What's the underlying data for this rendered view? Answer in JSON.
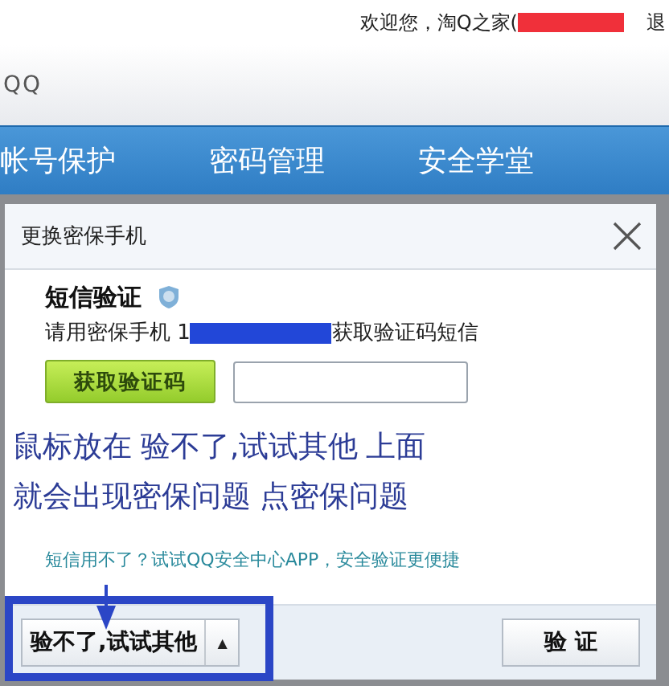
{
  "top_bar": {
    "welcome": "欢迎您，淘Q之家(",
    "logout": "退"
  },
  "header": {
    "logo_text": "QQ"
  },
  "nav": {
    "tabs": [
      {
        "label": "帐号保护",
        "selected": false
      },
      {
        "label": "密码管理",
        "selected": false
      },
      {
        "label": "安全学堂",
        "selected": false
      }
    ]
  },
  "dialog": {
    "title": "更换密保手机",
    "section_title": "短信验证",
    "instruction_prefix": "请用密保手机 1",
    "instruction_suffix": "获取验证码短信",
    "get_code_button": "获取验证码",
    "annotation": [
      "鼠标放在 验不了,试试其他 上面",
      "就会出现密保问题 点密保问题"
    ],
    "app_link": "短信用不了？试试QQ安全中心APP，安全验证更便捷",
    "other_button": "验不了,试试其他",
    "other_caret": "▲",
    "verify_button": "验 证"
  }
}
